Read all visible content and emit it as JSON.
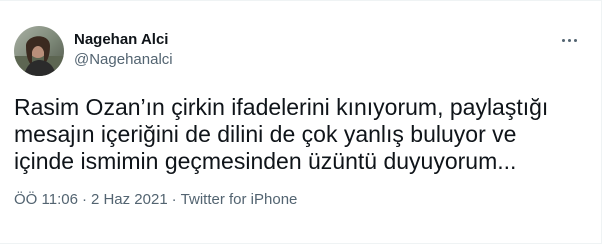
{
  "tweet": {
    "author": {
      "display_name": "Nagehan Alci",
      "handle": "@Nagehanalci"
    },
    "text": "Rasim Ozan’ın çirkin ifadelerini kınıyorum, paylaştığı\nmesajın içeriğini de dilini de çok yanlış buluyor ve\niçinde ismimin geçmesinden üzüntü duyuyorum...",
    "time": "ÖÖ 11:06",
    "separator": "·",
    "date": "2 Haz 2021",
    "source": "Twitter for iPhone"
  },
  "colors": {
    "text_primary": "#0f1419",
    "text_secondary": "#536471",
    "border": "#eff3f4"
  },
  "icons": {
    "more": "more-horizontal-icon"
  }
}
